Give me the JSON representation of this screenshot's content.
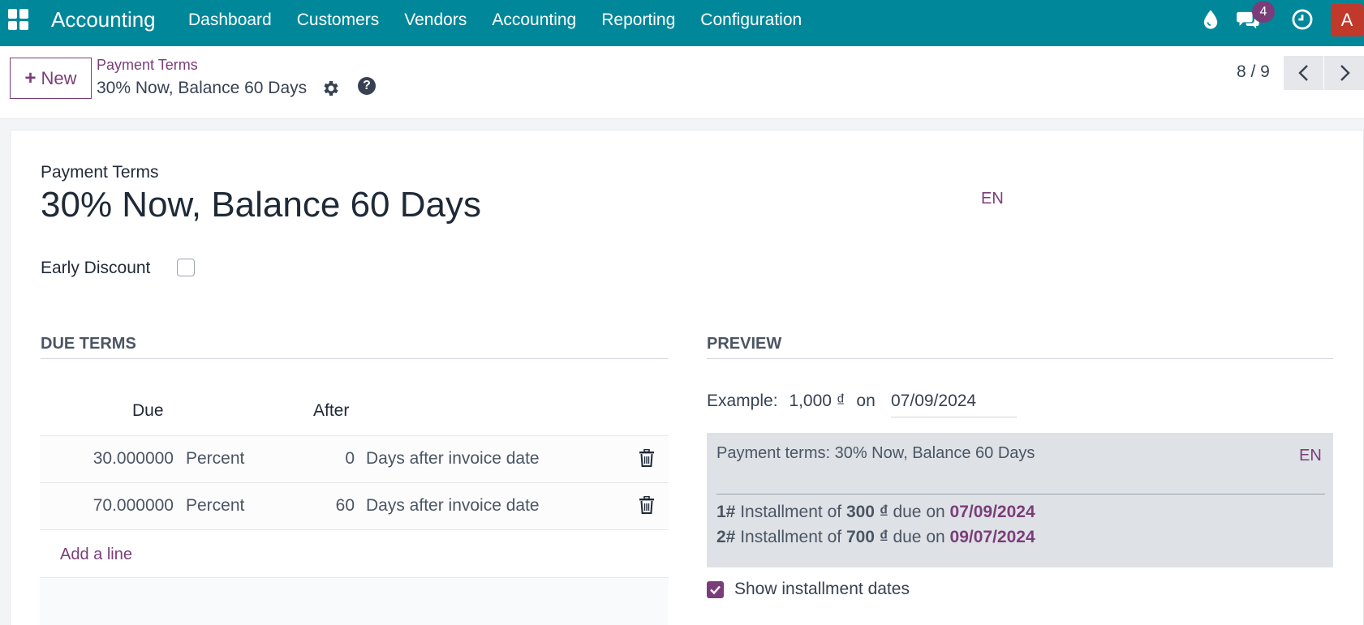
{
  "navbar": {
    "app_title": "Accounting",
    "menu": [
      "Dashboard",
      "Customers",
      "Vendors",
      "Accounting",
      "Reporting",
      "Configuration"
    ],
    "messages_count": "4",
    "avatar_letter": "A",
    "colors": {
      "bar": "#00889a",
      "avatar": "#c0392b",
      "badge": "#7b3d7a"
    }
  },
  "control": {
    "new_label": "New",
    "breadcrumb_parent": "Payment Terms",
    "breadcrumb_current": "30% Now, Balance 60 Days",
    "pager": "8 / 9"
  },
  "form": {
    "model_label": "Payment Terms",
    "name": "30% Now, Balance 60 Days",
    "lang": "EN",
    "early_discount_label": "Early Discount",
    "early_discount_checked": false
  },
  "due_terms": {
    "section_title": "DUE TERMS",
    "columns": {
      "due": "Due",
      "after": "After"
    },
    "rows": [
      {
        "value": "30.000000",
        "type": "Percent",
        "days": "0",
        "option": "Days after invoice date"
      },
      {
        "value": "70.000000",
        "type": "Percent",
        "days": "60",
        "option": "Days after invoice date"
      }
    ],
    "add_line": "Add a line"
  },
  "preview": {
    "section_title": "PREVIEW",
    "example_label": "Example:",
    "example_amount": "1,000 ₫",
    "example_on": "on",
    "example_date": "07/09/2024",
    "terms_text": "Payment terms: 30% Now, Balance 60 Days",
    "lang": "EN",
    "installments": [
      {
        "num": "1#",
        "prefix": "Installment of",
        "amount": "300 ₫",
        "mid": "due on",
        "date": "07/09/2024"
      },
      {
        "num": "2#",
        "prefix": "Installment of",
        "amount": "700 ₫",
        "mid": "due on",
        "date": "09/07/2024"
      }
    ],
    "show_dates_label": "Show installment dates",
    "show_dates_checked": true
  }
}
